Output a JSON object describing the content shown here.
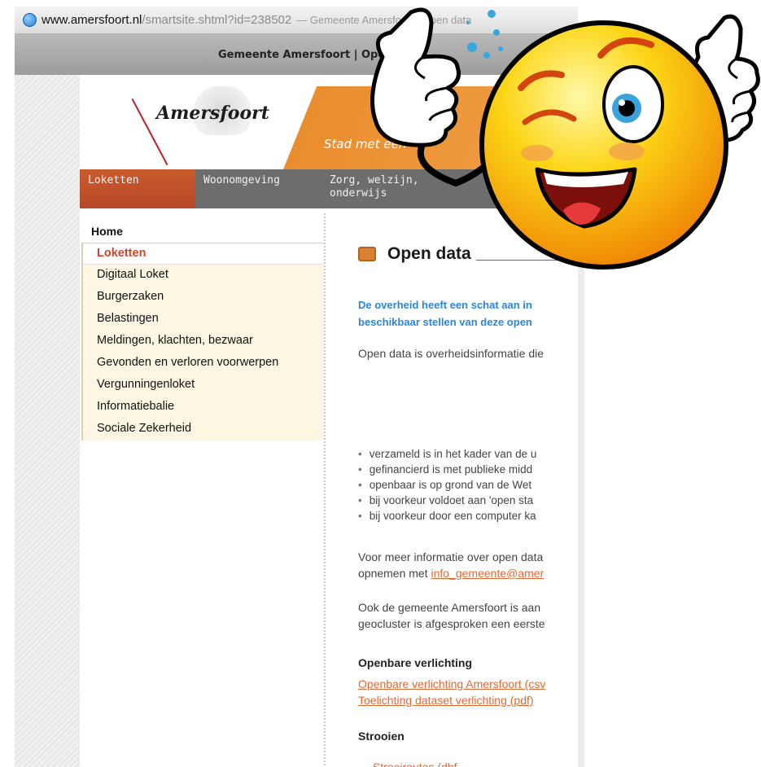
{
  "browser": {
    "url_host": "www.amersfoort.nl",
    "url_path": "/smartsite.shtml?id=238502",
    "url_title": "— Gemeente Amersfoort | Open data",
    "window_title": "Gemeente Amersfoort | Open data"
  },
  "header": {
    "logo_text": "Amersfoort",
    "tagline": "Stad met een"
  },
  "nav": {
    "items": [
      {
        "label": "Loketten"
      },
      {
        "label": "Woonomgeving"
      },
      {
        "label": "Zorg, welzijn,\nonderwijs"
      }
    ]
  },
  "sidebar": {
    "home": "Home",
    "items": [
      "Loketten",
      "Digitaal Loket",
      "Burgerzaken",
      "Belastingen",
      "Meldingen, klachten, bezwaar",
      "Gevonden en verloren voorwerpen",
      "Vergunningenloket",
      "Informatiebalie",
      "Sociale Zekerheid"
    ]
  },
  "content": {
    "title": "Open data",
    "intro_line1": "De overheid heeft een schat aan in",
    "intro_line2": "beschikbaar stellen van deze open",
    "p1": "Open data is overheidsinformatie die",
    "bullets": [
      "verzameld is in het kader van de u",
      "gefinancierd is met publieke midd",
      "openbaar is op grond van de Wet",
      "bij voorkeur voldoet aan 'open sta",
      "bij voorkeur door een computer ka"
    ],
    "p2_line1": "Voor meer informatie over open data",
    "p2_line2_pre": "opnemen met ",
    "p2_link": "info_gemeente@amer",
    "p3_line1": "Ook de gemeente Amersfoort is aan",
    "p3_line2": "geocluster is afgesproken een eerste",
    "h1": "Openbare verlichting",
    "link1": "Openbare verlichting Amersfoort (csv",
    "link2": "Toelichting dataset verlichting (pdf)",
    "h2": "Strooien",
    "link3": "Strooiroutes (dbf"
  }
}
